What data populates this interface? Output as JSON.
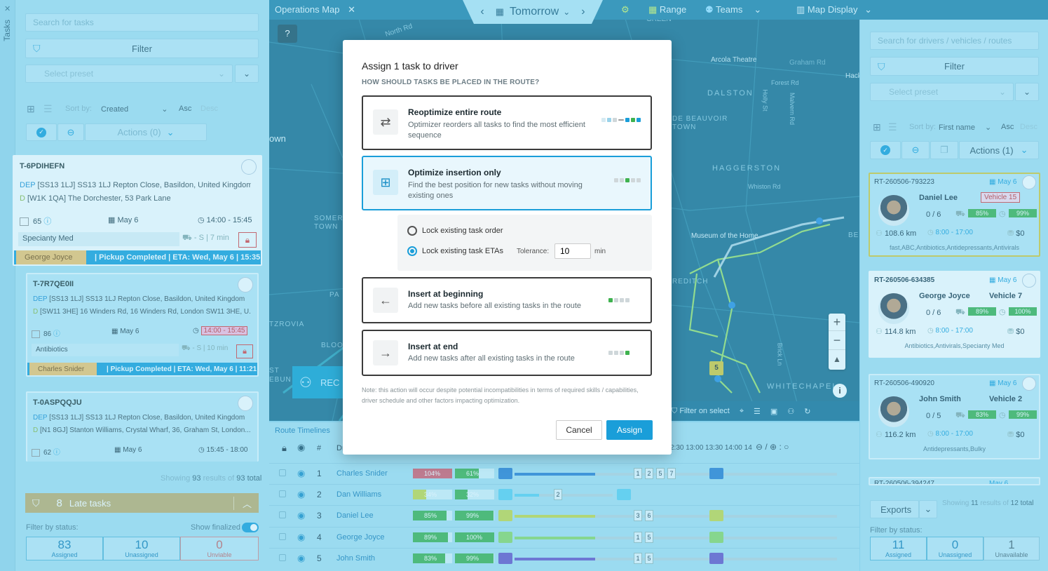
{
  "left": {
    "tab_label": "Tasks",
    "search_placeholder": "Search for tasks",
    "filter_label": "Filter",
    "preset_placeholder": "Select preset",
    "sort_by_label": "Sort by:",
    "sort_value": "Created",
    "asc_label": "Asc",
    "desc_label": "Desc",
    "actions_label": "Actions (0)",
    "cards": [
      {
        "id": "T-6PDIHEFN",
        "dep": "[SS13 1LJ] SS13 1LJ Repton Close, Basildon, United Kingdom...",
        "dest": "[W1K 1QA] The Dorchester, 53 Park Lane",
        "qty": "65",
        "date": "May 6",
        "time": "14:00 - 15:45",
        "tag": "Specianty Med",
        "dur": "- S | 7 min",
        "driver": "George Joyce",
        "status": "| Pickup Completed | ETA: Wed, May 6 | 15:35"
      },
      {
        "id": "T-7R7QE0II",
        "dep": "[SS13 1LJ] SS13 1LJ Repton Close, Basildon, United Kingdom",
        "dest": "[SW11 3HE] 16 Winders Rd, 16 Winders Rd, London SW11 3HE, U...",
        "qty": "86",
        "date": "May 6",
        "time": "14:00 - 15:45",
        "tag": "Antibiotics",
        "dur": "- S | 10 min",
        "driver": "Charles Snider",
        "status": "| Pickup Completed | ETA: Wed, May 6 | 11:21"
      },
      {
        "id": "T-0ASPQQJU",
        "dep": "[SS13 1LJ] SS13 1LJ Repton Close, Basildon, United Kingdom",
        "dest": "[N1 8GJ] Stanton Williams, Crystal Wharf, 36, Graham St, London...",
        "qty": "62",
        "date": "May 6",
        "time": "15:45 - 18:00"
      }
    ],
    "dep_label": "DEP",
    "dest_label": "D",
    "showing_prefix": "Showing",
    "showing_count": "93",
    "showing_mid": "results of",
    "showing_total": "93 total",
    "late_count": "8",
    "late_label": "Late tasks",
    "filter_status_label": "Filter by status:",
    "show_finalized_label": "Show finalized",
    "stats": [
      {
        "n": "83",
        "l": "Assigned"
      },
      {
        "n": "10",
        "l": "Unassigned"
      },
      {
        "n": "0",
        "l": "Unviable"
      }
    ]
  },
  "topbar": {
    "tab": "Operations Map",
    "date": "Tomorrow",
    "range": "Range",
    "teams": "Teams",
    "map_display": "Map Display"
  },
  "map": {
    "labels": [
      "GREEN",
      "North Rd",
      "Arcola Theatre",
      "Graham Rd",
      "Hack",
      "Forest Rd",
      "DALSTON",
      "DE BEAUVOIR TOWN",
      "HAGGERSTON",
      "Whiston Rd",
      "Museum of the Home",
      "SOMERS TOWN",
      "TZROVIA",
      "BLOO",
      "WHITECHAPEL",
      "own",
      "Brick Ln",
      "REDITCH",
      "Holly St",
      "Malvern Rd",
      "BE",
      "PA",
      "ST",
      "EBUN"
    ],
    "cluster_count": "5",
    "filter_on_select": "Filter on select",
    "rec_label": "REC"
  },
  "timeline": {
    "tab": "Route Timelines",
    "col_hash": "#",
    "col_driver": "Dr",
    "hours": "2:30 13:00 13:30 14:00 14",
    "rows": [
      {
        "n": "1",
        "name": "Charles Snider",
        "p1": "104%",
        "p2": "61%",
        "c": "#2b7fd0",
        "stops": [
          "1",
          "2",
          "5",
          "7"
        ]
      },
      {
        "n": "2",
        "name": "Dan Williams",
        "p1": "34%",
        "p2": "32%",
        "c": "#5fd0f0",
        "stops": [
          "2"
        ]
      },
      {
        "n": "3",
        "name": "Daniel Lee",
        "p1": "85%",
        "p2": "99%",
        "c": "#c8d94a",
        "stops": [
          "3",
          "6"
        ]
      },
      {
        "n": "4",
        "name": "George Joyce",
        "p1": "89%",
        "p2": "100%",
        "c": "#8cd868",
        "stops": [
          "1",
          "5"
        ]
      },
      {
        "n": "5",
        "name": "John Smith",
        "p1": "83%",
        "p2": "99%",
        "c": "#6a55c8",
        "stops": [
          "1",
          "5"
        ]
      }
    ],
    "progress": [
      {
        "p1": 1.0,
        "p2": 0.61
      },
      {
        "p1": 0.34,
        "p2": 0.32
      },
      {
        "p1": 0.85,
        "p2": 0.99
      },
      {
        "p1": 0.89,
        "p2": 1.0
      },
      {
        "p1": 0.83,
        "p2": 0.99
      }
    ]
  },
  "right": {
    "search_placeholder": "Search for drivers / vehicles / routes",
    "filter_label": "Filter",
    "preset_placeholder": "Select preset",
    "sort_by_label": "Sort by:",
    "sort_value": "First name",
    "asc_label": "Asc",
    "desc_label": "Desc",
    "actions_label": "Actions (1)",
    "routes": [
      {
        "id": "RT-260506-793223",
        "date": "May 6",
        "driver": "Daniel Lee",
        "vehicle": "Vehicle 15",
        "count": "0 / 6",
        "g1": "85%",
        "g2": "99%",
        "km": "108.6 km",
        "hours": "8:00 - 17:00",
        "cost": "$0",
        "tags": "fast,ABC,Antibiotics,Antidepressants,Antivirals"
      },
      {
        "id": "RT-260506-634385",
        "date": "May 6",
        "driver": "George Joyce",
        "vehicle": "Vehicle 7",
        "count": "0 / 6",
        "g1": "89%",
        "g2": "100%",
        "km": "114.8 km",
        "hours": "8:00 - 17:00",
        "cost": "$0",
        "tags": "Antibiotics,Antivirals,Specianty Med"
      },
      {
        "id": "RT-260506-490920",
        "date": "May 6",
        "driver": "John Smith",
        "vehicle": "Vehicle 2",
        "count": "0 / 5",
        "g1": "83%",
        "g2": "99%",
        "km": "116.2 km",
        "hours": "8:00 - 17:00",
        "cost": "$0",
        "tags": "Antidepressants,Bulky"
      }
    ],
    "next_route_id": "RT-260506-394247",
    "next_route_date": "May 6",
    "exports_label": "Exports",
    "showing_prefix": "Showing",
    "showing_count": "11",
    "showing_mid": "results of",
    "showing_total": "12 total",
    "filter_status_label": "Filter by status:",
    "stats": [
      {
        "n": "11",
        "l": "Assigned"
      },
      {
        "n": "0",
        "l": "Unassigned"
      },
      {
        "n": "1",
        "l": "Unavailable"
      }
    ]
  },
  "modal": {
    "title": "Assign 1 task to driver",
    "subtitle": "HOW SHOULD TASKS BE PLACED IN THE ROUTE?",
    "options": [
      {
        "title": "Reoptimize entire route",
        "desc": "Optimizer reorders all tasks to find the most efficient sequence"
      },
      {
        "title": "Optimize insertion only",
        "desc": "Find the best position for new tasks without moving existing ones"
      },
      {
        "title": "Insert at beginning",
        "desc": "Add new tasks before all existing tasks in the route"
      },
      {
        "title": "Insert at end",
        "desc": "Add new tasks after all existing tasks in the route"
      }
    ],
    "lock_order": "Lock existing task order",
    "lock_etas": "Lock existing task ETAs",
    "tolerance_label": "Tolerance:",
    "tolerance_value": "10",
    "tolerance_unit": "min",
    "note": "Note: this action will occur despite potential incompatibilities in terms of required skills / capabilities, driver schedule and other factors impacting optimization.",
    "cancel": "Cancel",
    "assign": "Assign"
  }
}
